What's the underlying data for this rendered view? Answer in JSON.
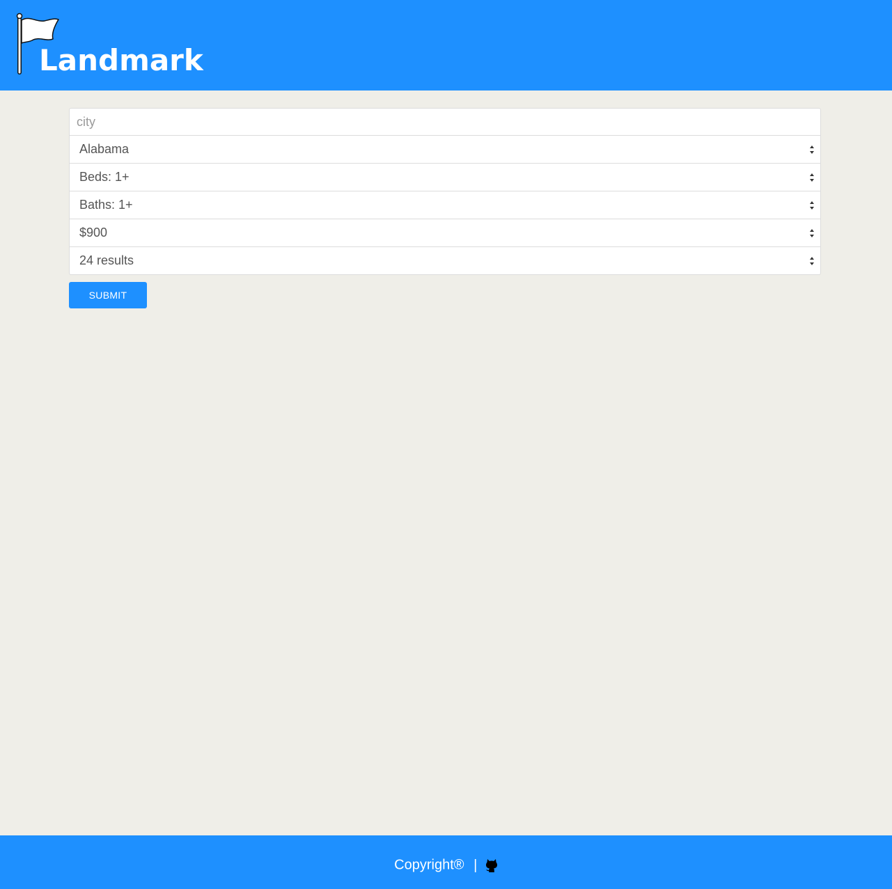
{
  "header": {
    "logo_text": "Landmark",
    "logo_icon": "flag-icon",
    "background": "#1e90ff"
  },
  "form": {
    "city": {
      "placeholder": "city",
      "value": ""
    },
    "state": {
      "selected": "Alabama"
    },
    "beds": {
      "selected": "Beds: 1+"
    },
    "baths": {
      "selected": "Baths: 1+"
    },
    "price": {
      "selected": "$900"
    },
    "results": {
      "selected": "24 results"
    },
    "submit_label": "SUBMIT"
  },
  "footer": {
    "copyright": "Copyright®",
    "separator": "|",
    "link_icon": "github-icon"
  },
  "colors": {
    "accent": "#1e90ff",
    "page_background": "#efeee8"
  }
}
